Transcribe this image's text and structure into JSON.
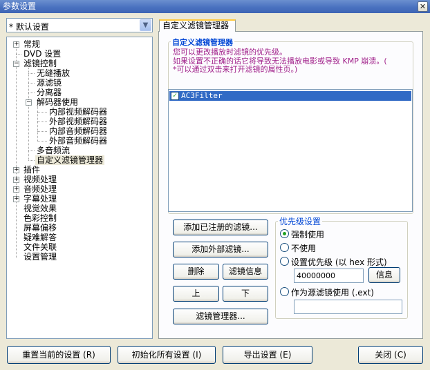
{
  "window": {
    "title": "参数设置",
    "close_glyph": "✕"
  },
  "preset": {
    "value": "* 默认设置"
  },
  "tree": {
    "items": [
      {
        "label": "常规",
        "expander": "+"
      },
      {
        "label": "DVD 设置"
      },
      {
        "label": "滤镜控制",
        "expander": "−"
      },
      {
        "label": "无缝播放"
      },
      {
        "label": "源滤镜"
      },
      {
        "label": "分离器"
      },
      {
        "label": "解码器使用",
        "expander": "−"
      },
      {
        "label": "内部视频解码器"
      },
      {
        "label": "外部视频解码器"
      },
      {
        "label": "内部音频解码器"
      },
      {
        "label": "外部音频解码器"
      },
      {
        "label": "多音频流"
      },
      {
        "label": "自定义滤镜管理器"
      },
      {
        "label": "插件",
        "expander": "+"
      },
      {
        "label": "视频处理",
        "expander": "+"
      },
      {
        "label": "音频处理",
        "expander": "+"
      },
      {
        "label": "字幕处理",
        "expander": "+"
      },
      {
        "label": "视觉效果"
      },
      {
        "label": "色彩控制"
      },
      {
        "label": "屏幕偏移"
      },
      {
        "label": "疑难解答"
      },
      {
        "label": "文件关联"
      },
      {
        "label": "设置管理"
      }
    ]
  },
  "tab": {
    "label": "自定义滤镜管理器"
  },
  "manager": {
    "title": "自定义滤镜管理器",
    "desc1": "您可以更改播放时滤镜的优先级。",
    "desc2": "如果设置不正确的话它将导致无法播放电影或导致 KMP 崩溃。(",
    "desc3": "*可以通过双击来打开滤镜的属性页。)",
    "filters": [
      {
        "name": "AC3Filter",
        "checked": true
      }
    ]
  },
  "buttons": {
    "add_registered": "添加已注册的滤镜...",
    "add_external": "添加外部滤镜...",
    "delete": "删除",
    "filter_info": "滤镜信息",
    "up": "上",
    "down": "下",
    "filter_manager": "滤镜管理器..."
  },
  "priority": {
    "title": "优先级设置",
    "force": "强制使用",
    "none": "不使用",
    "set": "设置优先级 (以 hex 形式)",
    "value": "40000000",
    "info_button": "信息",
    "as_source": "作为源滤镜使用 (.ext)",
    "source_value": "",
    "selected": "force"
  },
  "footer": {
    "reset": "重置当前的设置 (R)",
    "init_all": "初始化所有设置 (I)",
    "export": "导出设置 (E)",
    "close": "关闭 (C)"
  },
  "colors": {
    "titlebar": "#4a72c0",
    "group_title": "#0046d5",
    "description": "#a0208a",
    "selection": "#316ac5"
  }
}
